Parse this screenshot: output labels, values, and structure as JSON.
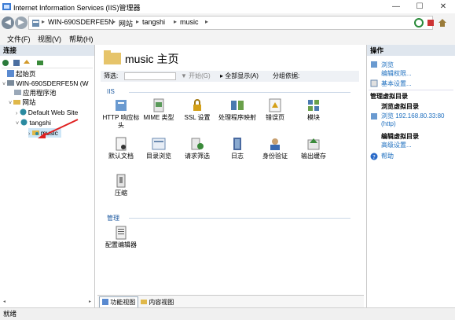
{
  "window": {
    "title": "Internet Information Services (IIS)管理器",
    "minimize": "—",
    "maximize": "☐",
    "close": "✕"
  },
  "address": {
    "seg1": "WIN-690SDERFE5N",
    "seg2": "网站",
    "seg3": "tangshi",
    "seg4": "music",
    "sep": "▸"
  },
  "menu": {
    "file": "文件(F)",
    "view": "视图(V)",
    "help": "帮助(H)"
  },
  "connections": {
    "title": "连接",
    "tree": [
      {
        "label": "起始页"
      },
      {
        "label": "WIN-690SDERFE5N (W"
      },
      {
        "label": "应用程序池"
      },
      {
        "label": "网站"
      },
      {
        "label": "Default Web Site"
      },
      {
        "label": "tangshi"
      },
      {
        "label": "music"
      }
    ]
  },
  "center": {
    "title": "music 主页",
    "filter_label": "筛选:",
    "filter_start": "开始(G)",
    "filter_showall": "全部显示(A)",
    "filter_groupby": "分组依据:",
    "group_iis": "IIS",
    "group_manage": "管理",
    "features": [
      {
        "label": "HTTP 响应标头"
      },
      {
        "label": "MIME 类型"
      },
      {
        "label": "SSL 设置"
      },
      {
        "label": "处理程序映射"
      },
      {
        "label": "错误页"
      },
      {
        "label": "模块"
      },
      {
        "label": "默认文档"
      },
      {
        "label": "目录浏览"
      },
      {
        "label": "请求筛选"
      },
      {
        "label": "日志"
      },
      {
        "label": "身份验证"
      },
      {
        "label": "输出缓存"
      },
      {
        "label": "压缩"
      }
    ],
    "manage_features": [
      {
        "label": "配置编辑器"
      }
    ]
  },
  "view_tabs": {
    "features": "功能视图",
    "content": "内容视图"
  },
  "actions": {
    "title": "操作",
    "browse": "浏览",
    "edit_permissions": "编辑权限...",
    "basic_settings": "基本设置...",
    "manage_vdir": "管理虚拟目录",
    "browse_vdir": "浏览虚拟目录",
    "browse_url": "浏览 192.168.80.33:80",
    "browse_url2": "(http)",
    "edit_vdir": "编辑虚拟目录",
    "advanced": "高级设置...",
    "help": "帮助"
  },
  "status": {
    "text": "就绪"
  }
}
